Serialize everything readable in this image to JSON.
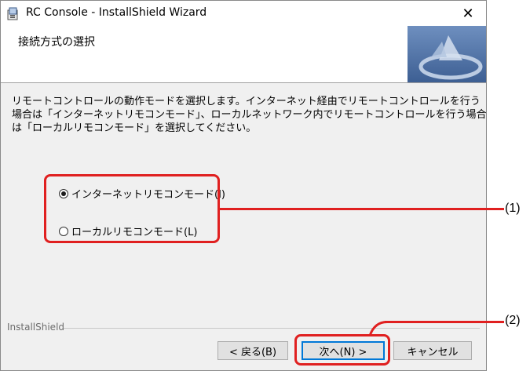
{
  "window": {
    "title": "RC Console - InstallShield Wizard",
    "close_glyph": "✕"
  },
  "header": {
    "title": "接続方式の選択"
  },
  "description": {
    "lines": [
      "リモートコントロールの動作モードを選択します。インターネット経由でリモートコントロールを行う",
      "場合は「インターネットリモコンモード」、ローカルネットワーク内でリモートコントロールを行う場合",
      "は「ローカルリモコンモード」を選択してください。"
    ]
  },
  "options": [
    {
      "label": "インターネットリモコンモード(I)",
      "selected": true
    },
    {
      "label": "ローカルリモコンモード(L)",
      "selected": false
    }
  ],
  "footer": {
    "brand": "InstallShield"
  },
  "buttons": {
    "back": "< 戻る(B)",
    "next": "次へ(N) >",
    "cancel": "キャンセル"
  },
  "callouts": {
    "options": "(1)",
    "next": "(2)"
  },
  "colors": {
    "highlight": "#e02020",
    "accent": "#0078d7",
    "header_graphic": "#4a6fa5"
  },
  "icons": {
    "app": "installer-icon",
    "header": "installshield-logo-graphic"
  }
}
